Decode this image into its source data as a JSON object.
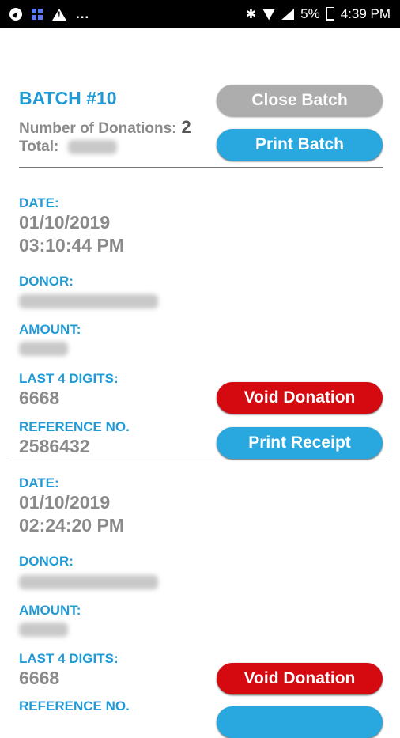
{
  "status_bar": {
    "icons_left": [
      "compass-icon",
      "app-grid-icon",
      "warning-icon"
    ],
    "more_indicator": "...",
    "battery": "5%",
    "time": "4:39 PM"
  },
  "batch": {
    "title": "BATCH #10",
    "donations_label": "Number of Donations:",
    "donations_count": "2",
    "total_label": "Total:",
    "close_label": "Close Batch",
    "print_label": "Print Batch"
  },
  "donations": [
    {
      "date_label": "DATE:",
      "date": "01/10/2019",
      "time": "03:10:44 PM",
      "donor_label": "DONOR:",
      "amount_label": "AMOUNT:",
      "digits_label": "LAST 4 DIGITS:",
      "digits": "6668",
      "ref_label": "REFERENCE NO.",
      "ref": "2586432",
      "void_label": "Void Donation",
      "receipt_label": "Print Receipt"
    },
    {
      "date_label": "DATE:",
      "date": "01/10/2019",
      "time": "02:24:20 PM",
      "donor_label": "DONOR:",
      "amount_label": "AMOUNT:",
      "digits_label": "LAST 4 DIGITS:",
      "digits": "6668",
      "ref_label": "REFERENCE NO.",
      "void_label": "Void Donation"
    }
  ],
  "colors": {
    "accent": "#1f9ad6",
    "primary_button": "#29a8e0",
    "danger_button": "#d40a10",
    "disabled_button": "#adadad"
  }
}
